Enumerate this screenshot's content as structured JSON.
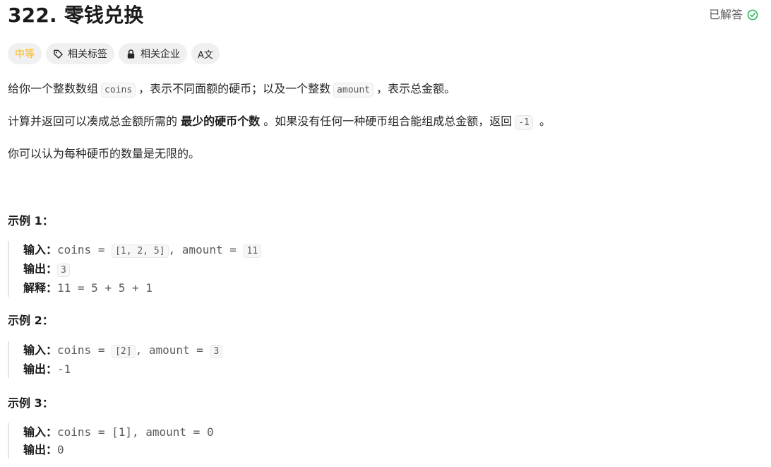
{
  "header": {
    "title": "322. 零钱兑换",
    "solved_label": "已解答",
    "solved_color": "#2db55d"
  },
  "tags": {
    "difficulty": "中等",
    "related_tags": "相关标签",
    "related_companies": "相关企业",
    "translate_icon_text": "A文"
  },
  "description": {
    "p1_a": "给你一个整数数组",
    "p1_code1": "coins",
    "p1_b": "，表示不同面额的硬币；以及一个整数",
    "p1_code2": "amount",
    "p1_c": "，表示总金额。",
    "p2_a": "计算并返回可以凑成总金额所需的 ",
    "p2_bold": "最少的硬币个数",
    "p2_b": " 。如果没有任何一种硬币组合能组成总金额，返回",
    "p2_code": "-1",
    "p2_c": " 。",
    "p3": "你可以认为每种硬币的数量是无限的。"
  },
  "examples": [
    {
      "title": "示例 1：",
      "input_label": "输入：",
      "input_pre": "coins = ",
      "input_code1": "[1, 2, 5]",
      "input_mid": ", amount = ",
      "input_code2": "11",
      "output_label": "输出：",
      "output_code": "3",
      "explain_label": "解释：",
      "explain": "11 = 5 + 5 + 1"
    },
    {
      "title": "示例 2：",
      "input_label": "输入：",
      "input_pre": "coins = ",
      "input_code1": "[2]",
      "input_mid": ", amount = ",
      "input_code2": "3",
      "output_label": "输出：",
      "output": "-1"
    },
    {
      "title": "示例 3：",
      "input_label": "输入：",
      "input": "coins = [1], amount = 0",
      "output_label": "输出：",
      "output": "0"
    }
  ]
}
